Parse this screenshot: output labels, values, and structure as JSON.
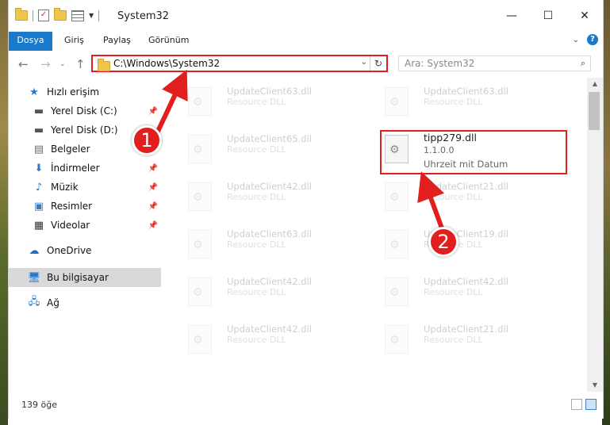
{
  "window": {
    "title": "System32",
    "controls": {
      "minimize": "—",
      "maximize": "☐",
      "close": "✕"
    }
  },
  "ribbon": {
    "tabs": [
      "Dosya",
      "Giriş",
      "Paylaş",
      "Görünüm"
    ]
  },
  "address": {
    "path": "C:\\Windows\\System32",
    "search_placeholder": "Ara: System32"
  },
  "sidebar": {
    "items": [
      {
        "label": "Hızlı erişim",
        "icon": "star-icon"
      },
      {
        "label": "Yerel Disk (C:)",
        "icon": "drive-icon",
        "pinned": true
      },
      {
        "label": "Yerel Disk (D:)",
        "icon": "drive-icon"
      },
      {
        "label": "Belgeler",
        "icon": "documents-icon",
        "pinned": true
      },
      {
        "label": "İndirmeler",
        "icon": "download-icon",
        "pinned": true
      },
      {
        "label": "Müzik",
        "icon": "music-icon",
        "pinned": true
      },
      {
        "label": "Resimler",
        "icon": "pictures-icon",
        "pinned": true
      },
      {
        "label": "Videolar",
        "icon": "videos-icon",
        "pinned": true
      },
      {
        "label": "OneDrive",
        "icon": "cloud-icon"
      },
      {
        "label": "Bu bilgisayar",
        "icon": "computer-icon",
        "selected": true
      },
      {
        "label": "Ağ",
        "icon": "network-icon"
      }
    ]
  },
  "files": {
    "left": [
      {
        "name": "UpdateClient63.dll",
        "desc": "Resource DLL"
      },
      {
        "name": "UpdateClient65.dll",
        "desc": "Resource DLL"
      },
      {
        "name": "UpdateClient42.dll",
        "desc": "Resource DLL"
      },
      {
        "name": "UpdateClient63.dll",
        "desc": "Resource DLL"
      },
      {
        "name": "UpdateClient42.dll",
        "desc": "Resource DLL"
      },
      {
        "name": "UpdateClient42.dll",
        "desc": "Resource DLL"
      }
    ],
    "right": [
      {
        "name": "UpdateClient63.dll",
        "desc": "Resource DLL"
      },
      {
        "name": "UpdateClient21.dll",
        "desc": "Resource DLL"
      },
      {
        "name": "UpdateClient19.dll",
        "desc": "Resource DLL"
      },
      {
        "name": "UpdateClient42.dll",
        "desc": "Resource DLL"
      },
      {
        "name": "UpdateClient21.dll",
        "desc": "Resource DLL"
      }
    ],
    "highlighted": {
      "name": "tipp279.dll",
      "version": "1.1.0.0",
      "desc": "Uhrzeit mit Datum"
    }
  },
  "status": {
    "count": "139 öğe"
  },
  "annotations": {
    "step1": "1",
    "step2": "2"
  },
  "colors": {
    "accent": "#1979ca",
    "highlight": "#e21f1f"
  }
}
